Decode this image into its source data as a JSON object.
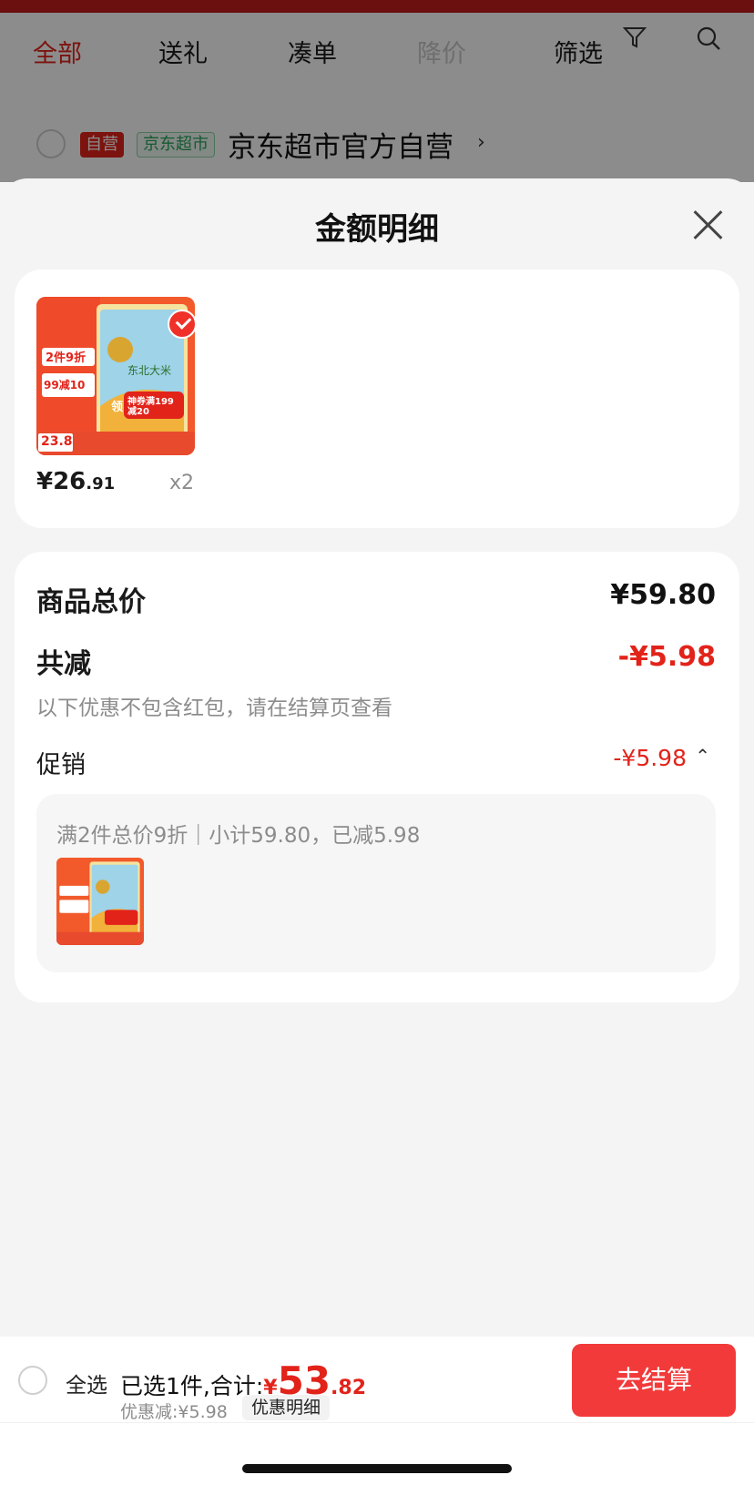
{
  "background": {
    "tabs": [
      "全部",
      "送礼",
      "凑单",
      "降价",
      "筛选"
    ],
    "shop": {
      "tag_self": "自营",
      "tag_jd": "京东超市",
      "name": "京东超市官方自营",
      "chevron": "›"
    }
  },
  "sheet": {
    "title": "金额明细",
    "product": {
      "price_main": "¥26",
      "price_decimal": ".91",
      "quantity": "x2",
      "image_texts": {
        "promo": "2件9折",
        "discount": "99减10",
        "brand": "东北大米",
        "coupon": "神券满199减20",
        "coupon_prefix": "领",
        "bottom_price": "23.8"
      }
    },
    "summary": {
      "total_label": "商品总价",
      "total_value": "¥59.80",
      "reduce_label": "共减",
      "reduce_value": "-¥5.98",
      "note": "以下优惠不包含红包，请在结算页查看",
      "promo_label": "促销",
      "promo_value": "-¥5.98",
      "promo_caret": "⌃",
      "promo_desc": "满2件总价9折｜小计59.80，已减5.98"
    }
  },
  "bottom": {
    "select_all": "全选",
    "selected_text": "已选1件,合计:",
    "yen": "¥",
    "total_int": "53",
    "total_dec": ".82",
    "discount_text": "优惠减:¥5.98",
    "detail_label": "优惠明细",
    "checkout": "去结算"
  },
  "colors": {
    "accent": "#e2231a",
    "checkout_button": "#f23a3a"
  }
}
